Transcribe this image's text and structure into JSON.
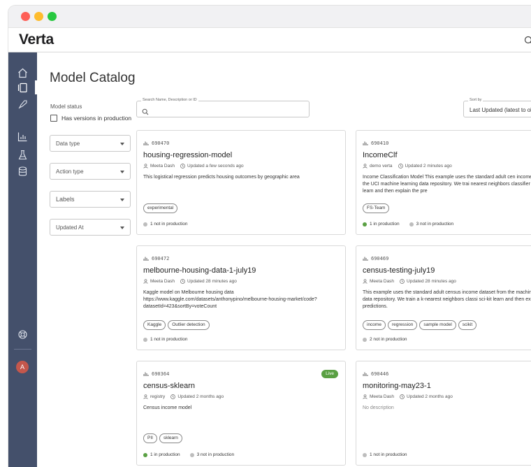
{
  "app": {
    "logo": "Verta"
  },
  "page": {
    "title": "Model Catalog"
  },
  "filters": {
    "status_label": "Model status",
    "has_versions_label": "Has versions in production",
    "selects": [
      "Data type",
      "Action type",
      "Labels",
      "Updated At"
    ]
  },
  "search": {
    "legend": "Search Name, Description or ID",
    "value": ""
  },
  "sort": {
    "legend": "Sort by",
    "value": "Last Updated (latest to ol"
  },
  "cards": [
    {
      "id": "690470",
      "name": "housing-regression-model",
      "author": "Meeta Dash",
      "updated": "Updated a few seconds ago",
      "description": "This logistical regression predicts housing outcomes by geographic area",
      "tags": [
        "experimental"
      ],
      "status_in": "",
      "status_not": "1 not in production",
      "live": ""
    },
    {
      "id": "690410",
      "name": "IncomeClf",
      "author": "demo verta",
      "updated": "Updated 2 minutes ago",
      "description": "Income Classification Model This example uses the standard adult cen income dataset from the UCI machine learning data repository. We trai nearest neighbors classifier using sci-kit learn and then explain the pre",
      "tags": [
        "FS-Team"
      ],
      "status_in": "1 in production",
      "status_not": "3 not in production",
      "live": ""
    },
    {
      "id": "690472",
      "name": "melbourne-housing-data-1-july19",
      "author": "Meeta Dash",
      "updated": "Updated 28 minutes ago",
      "description": "Kaggle model on Melbourne housing data https://www.kaggle.com/datasets/anthonypino/melbourne-housing-market/code?datasetId=423&sortBy=voteCount",
      "tags": [
        "Kaggle",
        "Outlier detection"
      ],
      "status_in": "",
      "status_not": "1 not in production",
      "live": ""
    },
    {
      "id": "690469",
      "name": "census-testing-july19",
      "author": "Meeta Dash",
      "updated": "Updated 28 minutes ago",
      "description": "This example uses the standard adult census income dataset from the machine learning data repository. We train a k-nearest neighbors classi sci-kit learn and then explain the predictions.",
      "tags": [
        "income",
        "regression",
        "sample model",
        "scikit"
      ],
      "status_in": "",
      "status_not": "2 not in production",
      "live": ""
    },
    {
      "id": "690364",
      "name": "census-sklearn",
      "author": "registry",
      "updated": "Updated 2 months ago",
      "description": "Census income model",
      "tags": [
        "PII",
        "sklearn"
      ],
      "status_in": "1 in production",
      "status_not": "3 not in production",
      "live": "Live"
    },
    {
      "id": "690446",
      "name": "monitoring-may23-1",
      "author": "Meeta Dash",
      "updated": "Updated 2 months ago",
      "description": "No description",
      "tags": [],
      "status_in": "",
      "status_not": "1 not in production",
      "live": ""
    }
  ],
  "user": {
    "initial": "A"
  },
  "colors": {
    "sidebar": "#44506b",
    "live": "#5aa043",
    "in_production": "#5aa043",
    "not_in_production": "#bdbdbd"
  }
}
